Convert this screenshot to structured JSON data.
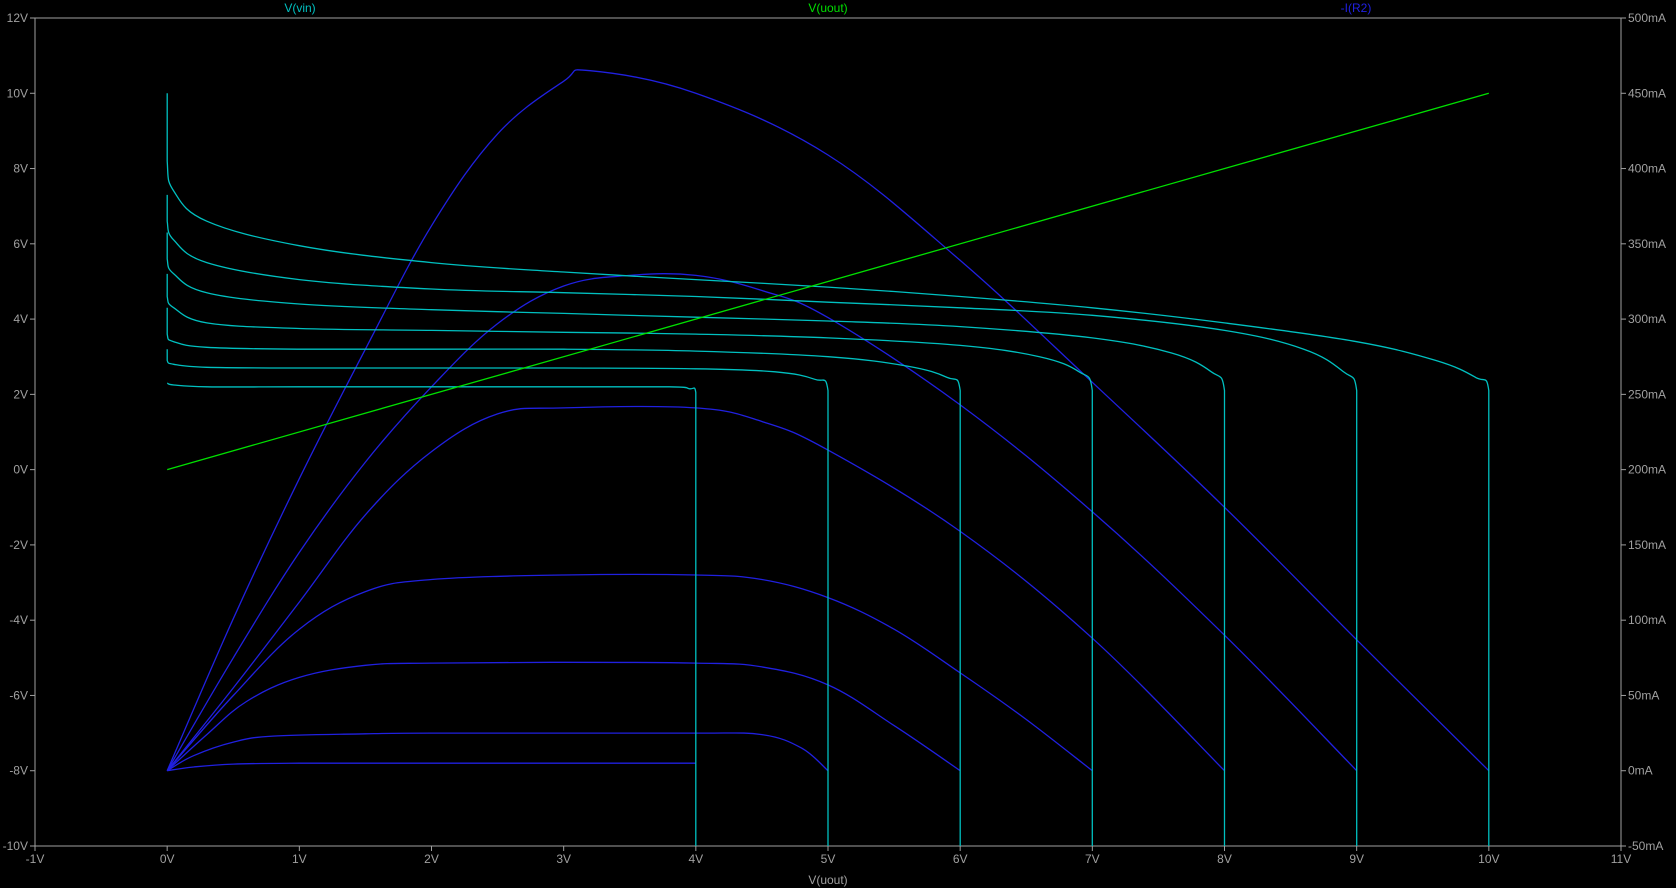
{
  "chart_data": {
    "type": "line",
    "xlabel": "V(uout)",
    "x_ticks": [
      "-1V",
      "0V",
      "1V",
      "2V",
      "3V",
      "4V",
      "5V",
      "6V",
      "7V",
      "8V",
      "9V",
      "10V",
      "11V"
    ],
    "left_ticks": [
      "12V",
      "10V",
      "8V",
      "6V",
      "4V",
      "2V",
      "0V",
      "-2V",
      "-4V",
      "-6V",
      "-8V",
      "-10V"
    ],
    "right_ticks": [
      "500mA",
      "450mA",
      "400mA",
      "350mA",
      "300mA",
      "250mA",
      "200mA",
      "150mA",
      "100mA",
      "50mA",
      "0mA",
      "-50mA"
    ],
    "xlim": [
      -1,
      11
    ],
    "ylim_left": [
      -10,
      12
    ],
    "ylim_right": [
      -50,
      500
    ],
    "grid": false,
    "legend": [
      {
        "label": "V(vin)",
        "color": "#00c0c0"
      },
      {
        "label": "V(uout)",
        "color": "#00e000"
      },
      {
        "label": "-I(R2)",
        "color": "#2020e0"
      }
    ],
    "series": [
      {
        "name": "V(uout)",
        "axis": "left",
        "color": "#00e000",
        "x": [
          0,
          10
        ],
        "y": [
          0,
          10
        ]
      },
      {
        "name": "V(vin)",
        "axis": "left",
        "color": "#00c0c0",
        "x": [
          0,
          0.05,
          0.3,
          1,
          2,
          3,
          3.8,
          3.95,
          4,
          4,
          4,
          4,
          4,
          4
        ],
        "y": [
          2.3,
          2.25,
          2.2,
          2.2,
          2.2,
          2.2,
          2.2,
          2.15,
          2.05,
          1.0,
          0,
          -6,
          -9,
          -10
        ]
      },
      {
        "name": "V(vin)",
        "axis": "left",
        "color": "#00c0c0",
        "x": [
          0,
          0,
          0.05,
          0.3,
          1,
          2,
          3,
          4,
          4.6,
          4.9,
          5,
          5,
          5
        ],
        "y": [
          3.2,
          2.9,
          2.8,
          2.72,
          2.7,
          2.7,
          2.7,
          2.68,
          2.6,
          2.4,
          2.1,
          0,
          -10
        ]
      },
      {
        "name": "V(vin)",
        "axis": "left",
        "color": "#00c0c0",
        "x": [
          0,
          0,
          0.05,
          0.3,
          1,
          2,
          3,
          4,
          5,
          5.6,
          5.9,
          6,
          6,
          6
        ],
        "y": [
          4.3,
          3.6,
          3.4,
          3.25,
          3.2,
          3.2,
          3.2,
          3.15,
          3.0,
          2.75,
          2.45,
          2.1,
          0,
          -10
        ]
      },
      {
        "name": "V(vin)",
        "axis": "left",
        "color": "#00c0c0",
        "x": [
          0,
          0,
          0.05,
          0.3,
          1,
          2,
          3,
          4,
          5,
          6,
          6.6,
          6.9,
          7,
          7,
          7
        ],
        "y": [
          5.2,
          4.6,
          4.3,
          3.9,
          3.75,
          3.7,
          3.65,
          3.6,
          3.5,
          3.3,
          3.0,
          2.6,
          2.1,
          0,
          -10
        ]
      },
      {
        "name": "V(vin)",
        "axis": "left",
        "color": "#00c0c0",
        "x": [
          0,
          0,
          0.05,
          0.3,
          1,
          2,
          3,
          4,
          5,
          6,
          7,
          7.6,
          7.9,
          8,
          8,
          8
        ],
        "y": [
          6.3,
          5.6,
          5.2,
          4.7,
          4.4,
          4.25,
          4.15,
          4.05,
          3.95,
          3.8,
          3.5,
          3.1,
          2.6,
          2.1,
          0,
          -10
        ]
      },
      {
        "name": "V(vin)",
        "axis": "left",
        "color": "#00c0c0",
        "x": [
          0,
          0,
          0.05,
          0.3,
          1,
          2,
          3,
          4,
          5,
          6,
          7,
          8,
          8.6,
          8.9,
          9,
          9,
          9
        ],
        "y": [
          7.3,
          6.6,
          6.1,
          5.5,
          5.05,
          4.8,
          4.7,
          4.6,
          4.45,
          4.3,
          4.1,
          3.7,
          3.2,
          2.6,
          2.1,
          0,
          -10
        ]
      },
      {
        "name": "V(vin)",
        "axis": "left",
        "color": "#00c0c0",
        "x": [
          0,
          0,
          0.05,
          0.3,
          1,
          2,
          3,
          4,
          5,
          6,
          7,
          8,
          9,
          9.6,
          9.9,
          10,
          10,
          10
        ],
        "y": [
          10,
          8.2,
          7.4,
          6.6,
          5.95,
          5.5,
          5.25,
          5.05,
          4.85,
          4.6,
          4.3,
          3.9,
          3.4,
          2.9,
          2.45,
          2.1,
          0,
          -10
        ]
      },
      {
        "name": "-I(R2)",
        "axis": "right",
        "color": "#2020e0",
        "x": [
          0,
          0.2,
          0.5,
          1,
          2,
          3,
          3.5,
          4
        ],
        "y": [
          0,
          2.5,
          4.4,
          5.0,
          5.0,
          5.0,
          5.0,
          5.0
        ]
      },
      {
        "name": "-I(R2)",
        "axis": "right",
        "color": "#2020e0",
        "x": [
          0,
          0.2,
          0.5,
          0.8,
          1.5,
          2,
          3,
          4,
          4.5,
          4.8,
          5
        ],
        "y": [
          0,
          10,
          19,
          23,
          24.5,
          25,
          25,
          25,
          24,
          15,
          0
        ]
      },
      {
        "name": "-I(R2)",
        "axis": "right",
        "color": "#2020e0",
        "x": [
          0,
          0.3,
          0.6,
          1,
          1.5,
          2,
          3,
          4,
          4.5,
          5,
          5.5,
          6
        ],
        "y": [
          0,
          24,
          46,
          62,
          70,
          71.5,
          72,
          71.5,
          69,
          57,
          30,
          0
        ]
      },
      {
        "name": "-I(R2)",
        "axis": "right",
        "color": "#2020e0",
        "x": [
          0,
          0.5,
          1,
          1.5,
          2,
          3,
          4,
          4.5,
          5,
          5.5,
          6,
          6.5,
          7
        ],
        "y": [
          0,
          50,
          94,
          119,
          127,
          130,
          130,
          127,
          115,
          94,
          65,
          34,
          0
        ]
      },
      {
        "name": "-I(R2)",
        "axis": "right",
        "color": "#2020e0",
        "x": [
          0,
          0.5,
          1,
          1.5,
          2,
          2.5,
          3,
          4,
          4.5,
          5,
          6,
          7,
          8
        ],
        "y": [
          0,
          55,
          112,
          170,
          212,
          237,
          241,
          241,
          232,
          213,
          159,
          88,
          0
        ]
      },
      {
        "name": "-I(R2)",
        "axis": "right",
        "color": "#2020e0",
        "x": [
          0,
          0.5,
          1,
          1.5,
          2,
          2.5,
          3,
          3.5,
          4,
          4.5,
          5,
          6,
          7,
          8,
          9
        ],
        "y": [
          0,
          75,
          145,
          205,
          255,
          297,
          322,
          329,
          329,
          319,
          301,
          243,
          172,
          90,
          0
        ]
      },
      {
        "name": "-I(R2)",
        "axis": "right",
        "color": "#2020e0",
        "x": [
          0,
          0.5,
          1,
          1.5,
          2,
          2.5,
          3,
          3.2,
          4,
          5,
          6,
          7,
          8,
          9,
          10
        ],
        "y": [
          0,
          101,
          194,
          280,
          362,
          423,
          458,
          465,
          450,
          409,
          339,
          258,
          175,
          87,
          0
        ]
      }
    ]
  }
}
